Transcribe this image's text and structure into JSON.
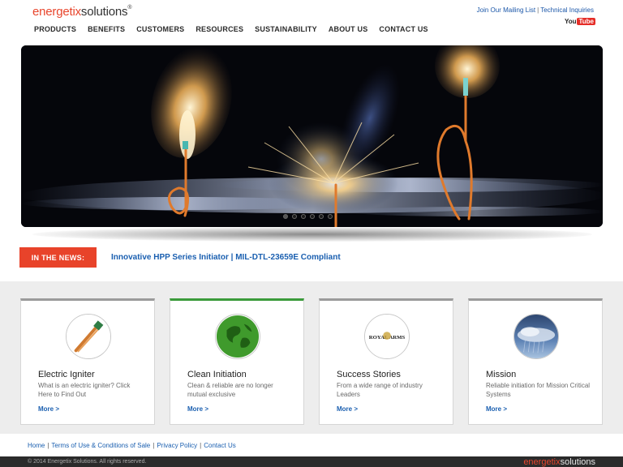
{
  "brand": {
    "logo_part1": "energetix",
    "logo_part2": "solutions",
    "registered": "®"
  },
  "top_links": {
    "mailing": "Join Our Mailing List",
    "separator": "|",
    "tech": "Technical Inquiries"
  },
  "youtube": {
    "you": "You",
    "tube": "Tube"
  },
  "nav": [
    {
      "label": "PRODUCTS"
    },
    {
      "label": "BENEFITS"
    },
    {
      "label": "CUSTOMERS"
    },
    {
      "label": "RESOURCES"
    },
    {
      "label": "SUSTAINABILITY"
    },
    {
      "label": "ABOUT US"
    },
    {
      "label": "CONTACT US"
    }
  ],
  "slider": {
    "total_slides": 6,
    "active_index": 0
  },
  "news": {
    "label": "IN THE NEWS:",
    "headline": "Innovative HPP Series Initiator | MIL-DTL-23659E Compliant"
  },
  "cards": [
    {
      "title": "Electric Igniter",
      "desc": "What is an electric igniter? Click Here to Find Out",
      "more": "More >",
      "icon": "igniter-icon",
      "accent": "#9a9a9a"
    },
    {
      "title": "Clean Initiation",
      "desc": "Clean & reliable are no longer mutual exclusive",
      "more": "More >",
      "icon": "globe-icon",
      "accent": "#3a9a3a"
    },
    {
      "title": "Success Stories",
      "desc": "From a wide range of industry Leaders",
      "more": "More >",
      "icon": "royal-arms-logo",
      "logo_text": "ROYAL ARMS",
      "accent": "#9a9a9a"
    },
    {
      "title": "Mission",
      "desc": "Reliable initiation for Mission Critical Systems",
      "more": "More >",
      "icon": "storm-cloud-icon",
      "accent": "#9a9a9a"
    }
  ],
  "footer": {
    "links": [
      "Home",
      "Terms of Use & Conditions of Sale",
      "Privacy Policy",
      "Contact Us"
    ],
    "copyright": "© 2014 Energetix Solutions. All rights reserved.",
    "logo_part1": "energetix",
    "logo_part2": "solutions",
    "registered": "®"
  },
  "colors": {
    "brand_red": "#e8452c",
    "link_blue": "#1a5fb0",
    "news_red": "#e8432a",
    "clean_green": "#3a9a3a"
  }
}
